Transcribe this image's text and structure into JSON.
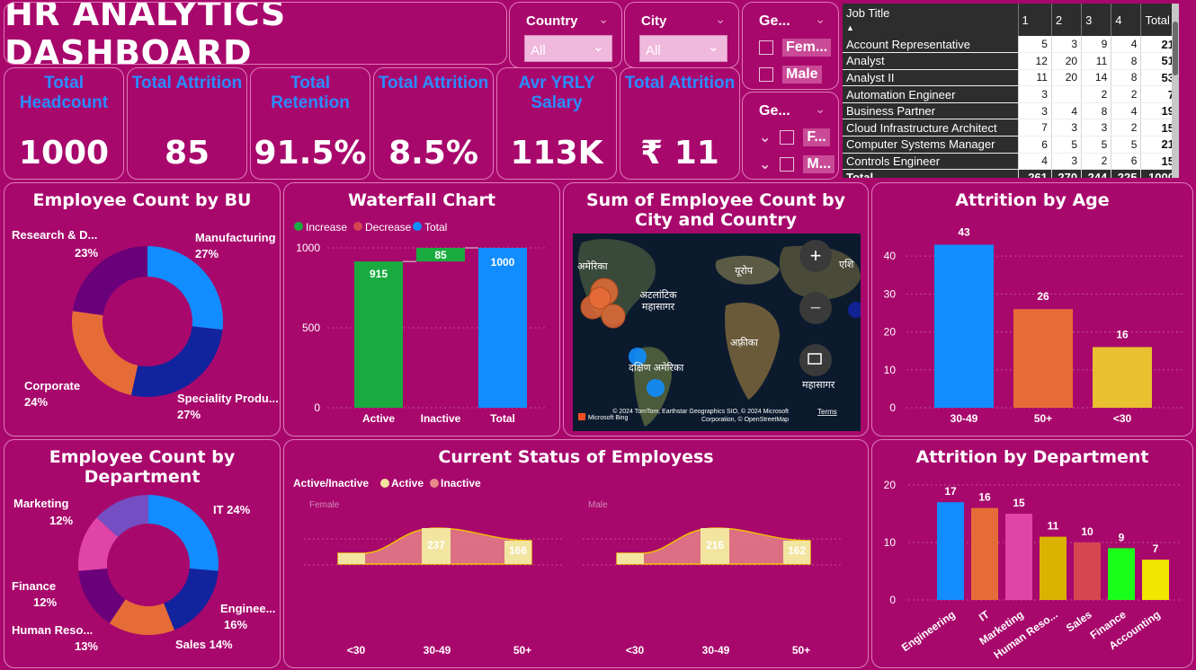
{
  "header": {
    "title": "HR ANALYTICS DASHBOARD"
  },
  "slicers": {
    "country": {
      "label": "Country",
      "value": "All"
    },
    "city": {
      "label": "City",
      "value": "All"
    },
    "gender1": {
      "label": "Ge...",
      "options": [
        "Fem...",
        "Male"
      ]
    },
    "gender2": {
      "label": "Ge...",
      "options": [
        "F...",
        "M..."
      ]
    }
  },
  "kpis": [
    {
      "label": "Total Headcount",
      "value": "1000"
    },
    {
      "label": "Total Attrition",
      "value": "85"
    },
    {
      "label": "Total Retention",
      "value": "91.5%"
    },
    {
      "label": "Total Attrition",
      "value": "8.5%"
    },
    {
      "label": "Avr YRLY Salary",
      "value": "113K"
    },
    {
      "label": "Total Attrition",
      "value": "₹ 11"
    }
  ],
  "matrix": {
    "headers": [
      "Job Title",
      "1",
      "2",
      "3",
      "4",
      "Total"
    ],
    "rows": [
      [
        "Account Representative",
        "5",
        "3",
        "9",
        "4",
        "21"
      ],
      [
        "Analyst",
        "12",
        "20",
        "11",
        "8",
        "51"
      ],
      [
        "Analyst II",
        "11",
        "20",
        "14",
        "8",
        "53"
      ],
      [
        "Automation Engineer",
        "3",
        "",
        "2",
        "2",
        "7"
      ],
      [
        "Business Partner",
        "3",
        "4",
        "8",
        "4",
        "19"
      ],
      [
        "Cloud Infrastructure Architect",
        "7",
        "3",
        "3",
        "2",
        "15"
      ],
      [
        "Computer Systems Manager",
        "6",
        "5",
        "5",
        "5",
        "21"
      ],
      [
        "Controls Engineer",
        "4",
        "3",
        "2",
        "6",
        "15"
      ]
    ],
    "total": [
      "Total",
      "261",
      "270",
      "244",
      "225",
      "1000"
    ]
  },
  "map": {
    "title": "Sum of Employee Count by City and Country",
    "labels": [
      "अमेरिका",
      "अटलांटिक महासागर",
      "यूरोप",
      "अफ़्रीका",
      "दक्षिण अमेरिका",
      "महासागर",
      "एशि"
    ],
    "attribution": "© 2024 TomTom, Earthstar Geographics SIO, © 2024 Microsoft Corporation, © OpenStreetMap",
    "terms": "Terms",
    "brand": "Microsoft Bing"
  },
  "chart_data": [
    {
      "type": "pie",
      "title": "Employee Count by BU",
      "categories": [
        "Manufacturing",
        "Speciality Produ...",
        "Corporate",
        "Research & D..."
      ],
      "values": [
        27,
        27,
        24,
        23
      ],
      "colors": [
        "#118dff",
        "#12239e",
        "#e66c37",
        "#6b007b"
      ]
    },
    {
      "type": "bar",
      "title": "Waterfall Chart",
      "legend": [
        "Increase",
        "Decrease",
        "Total"
      ],
      "categories": [
        "Active",
        "Inactive",
        "Total"
      ],
      "values": [
        915,
        85,
        1000
      ],
      "ylim": [
        0,
        1000
      ],
      "yticks": [
        0,
        500,
        1000
      ],
      "colors": {
        "Increase": "#1aab40",
        "Decrease": "#d64550",
        "Total": "#118dff"
      }
    },
    {
      "type": "bar",
      "title": "Attrition by Age",
      "categories": [
        "30-49",
        "50+",
        "<30"
      ],
      "values": [
        43,
        26,
        16
      ],
      "ylim": [
        0,
        45
      ],
      "yticks": [
        0,
        10,
        20,
        30,
        40
      ],
      "colors": [
        "#118dff",
        "#e66c37",
        "#e8c030"
      ]
    },
    {
      "type": "pie",
      "title": "Employee Count by Department",
      "categories": [
        "IT 24%",
        "Enginee...",
        "Sales 14%",
        "Human Reso...",
        "Finance",
        "Marketing"
      ],
      "values": [
        24,
        16,
        14,
        13,
        12,
        12
      ],
      "percent_labels": [
        "",
        "16%",
        "",
        "13%",
        "12%",
        "12%"
      ],
      "colors": [
        "#118dff",
        "#12239e",
        "#e66c37",
        "#6b007b",
        "#e044a7",
        "#744ec2",
        "#d9b300"
      ]
    },
    {
      "type": "area",
      "title": "Current Status of Employess",
      "legend_title": "Active/Inactive",
      "legend": [
        "Active",
        "Inactive"
      ],
      "colors": {
        "Active": "#f2e5a0",
        "Inactive": "#e88a8a"
      },
      "panels": [
        {
          "name": "Female",
          "categories": [
            "<30",
            "30-49",
            "50+"
          ],
          "labels": [
            "",
            "237",
            "166"
          ]
        },
        {
          "name": "Male",
          "categories": [
            "<30",
            "30-49",
            "50+"
          ],
          "labels": [
            "",
            "216",
            "162"
          ]
        }
      ]
    },
    {
      "type": "bar",
      "title": "Attrition by Department",
      "categories": [
        "Engineering",
        "IT",
        "Marketing",
        "Human Reso...",
        "Sales",
        "Finance",
        "Accounting"
      ],
      "values": [
        17,
        16,
        15,
        11,
        10,
        9,
        7
      ],
      "ylim": [
        0,
        20
      ],
      "yticks": [
        0,
        10,
        20
      ],
      "colors": [
        "#118dff",
        "#e66c37",
        "#e044a7",
        "#d9b300",
        "#d64550",
        "#1aff1a",
        "#f0e600"
      ]
    }
  ]
}
